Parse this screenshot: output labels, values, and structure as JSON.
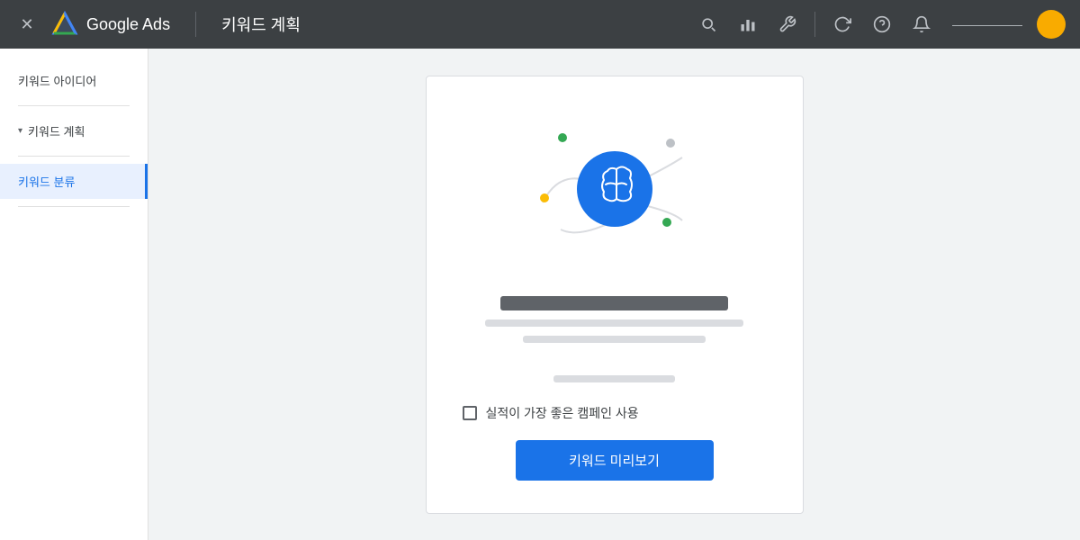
{
  "header": {
    "app_title": "Google Ads",
    "page_title": "키워드 계획",
    "account_name": "——————",
    "icons": {
      "close": "✕",
      "search": "🔍",
      "chart": "📊",
      "tool": "🔧",
      "refresh": "↻",
      "help": "?",
      "bell": "🔔"
    }
  },
  "sidebar": {
    "items": [
      {
        "id": "keyword-ideas",
        "label": "키워드 아이디어",
        "active": false,
        "arrow": false
      },
      {
        "id": "keyword-plan",
        "label": "키워드 계획",
        "active": false,
        "arrow": true
      },
      {
        "id": "keyword-category",
        "label": "키워드 분류",
        "active": true,
        "arrow": false
      }
    ]
  },
  "card": {
    "checkbox_label": "실적이 가장 좋은 캠페인 사용",
    "button_label": "키워드 미리보기"
  }
}
